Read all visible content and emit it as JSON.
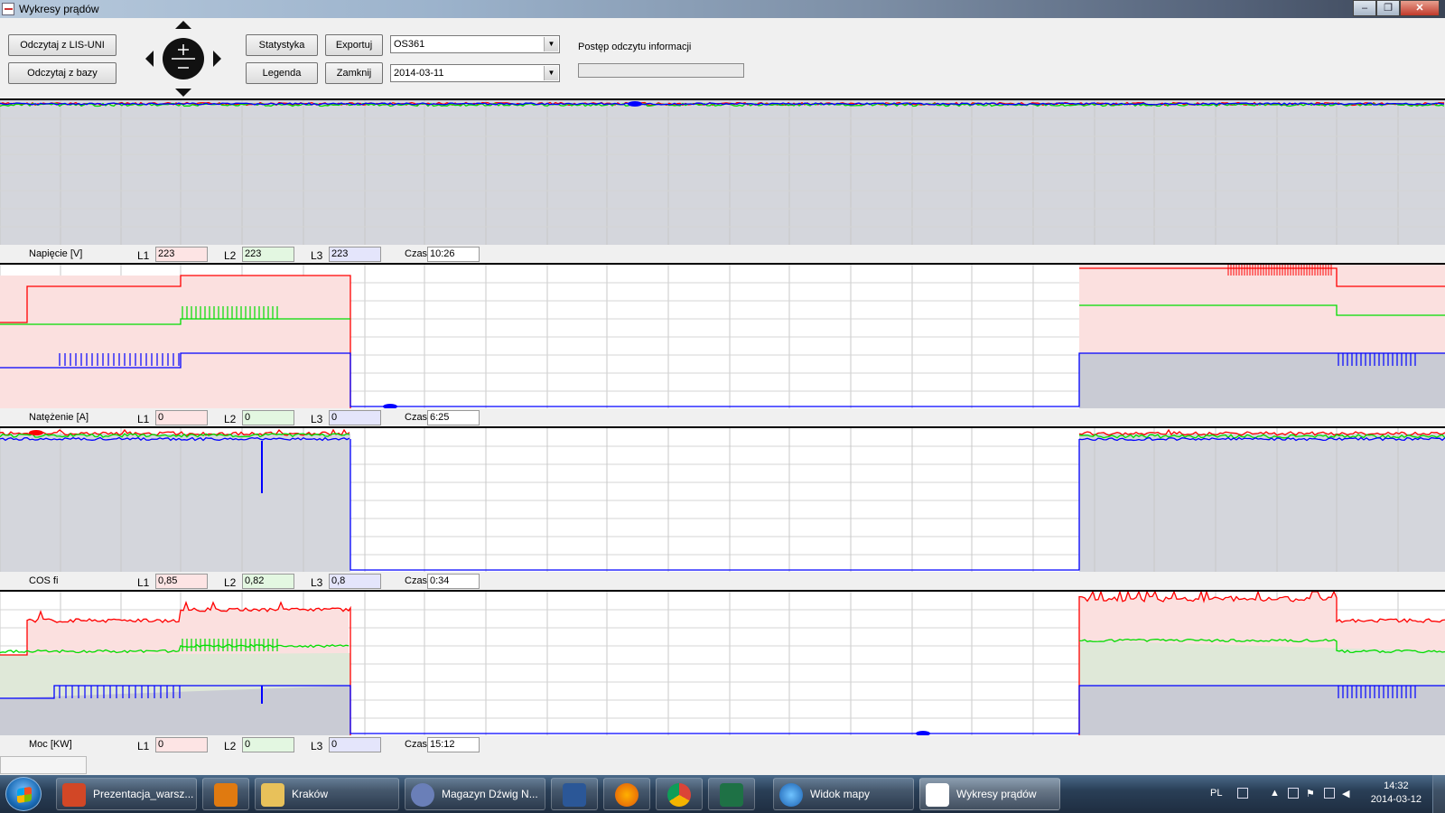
{
  "window": {
    "title": "Wykresy prądów"
  },
  "toolbar": {
    "read_lis": "Odczytaj z LIS-UNI",
    "read_db": "Odczytaj z bazy",
    "stats": "Statystyka",
    "legend": "Legenda",
    "export": "Exportuj",
    "close": "Zamknij",
    "device": "OS361",
    "date": "2014-03-11",
    "progress_label": "Postęp odczytu informacji",
    "progress": 0
  },
  "panels": [
    {
      "name": "Napięcie [V]",
      "L1": "223",
      "L2": "223",
      "L3": "223",
      "czas": "10:26"
    },
    {
      "name": "Natężenie [A]",
      "L1": "0",
      "L2": "0",
      "L3": "0",
      "czas": "6:25"
    },
    {
      "name": "COS fi",
      "L1": "0,85",
      "L2": "0,82",
      "L3": "0,8",
      "czas": "0:34"
    },
    {
      "name": "Moc [KW]",
      "L1": "0",
      "L2": "0",
      "L3": "0",
      "czas": "15:12"
    }
  ],
  "labels": {
    "l1": "L1",
    "l2": "L2",
    "l3": "L3",
    "czas": "Czas"
  },
  "colors": {
    "L1": "#ff0000",
    "L2": "#00dd00",
    "L3": "#0000ff"
  },
  "taskbar": {
    "items": [
      "Prezentacja_warsz...",
      "Kraków",
      "Magazyn Dźwig N...",
      "Widok mapy",
      "Wykresy prądów"
    ],
    "lang": "PL",
    "time": "14:32",
    "date": "2014-03-12"
  }
}
